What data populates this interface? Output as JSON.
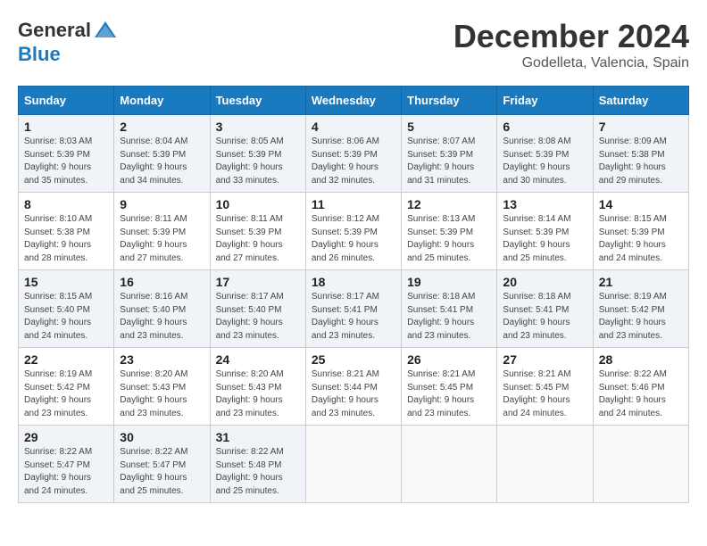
{
  "header": {
    "logo_general": "General",
    "logo_blue": "Blue",
    "month_title": "December 2024",
    "location": "Godelleta, Valencia, Spain"
  },
  "weekdays": [
    "Sunday",
    "Monday",
    "Tuesday",
    "Wednesday",
    "Thursday",
    "Friday",
    "Saturday"
  ],
  "weeks": [
    [
      {
        "day": "1",
        "sunrise": "8:03 AM",
        "sunset": "5:39 PM",
        "daylight": "9 hours and 35 minutes."
      },
      {
        "day": "2",
        "sunrise": "8:04 AM",
        "sunset": "5:39 PM",
        "daylight": "9 hours and 34 minutes."
      },
      {
        "day": "3",
        "sunrise": "8:05 AM",
        "sunset": "5:39 PM",
        "daylight": "9 hours and 33 minutes."
      },
      {
        "day": "4",
        "sunrise": "8:06 AM",
        "sunset": "5:39 PM",
        "daylight": "9 hours and 32 minutes."
      },
      {
        "day": "5",
        "sunrise": "8:07 AM",
        "sunset": "5:39 PM",
        "daylight": "9 hours and 31 minutes."
      },
      {
        "day": "6",
        "sunrise": "8:08 AM",
        "sunset": "5:39 PM",
        "daylight": "9 hours and 30 minutes."
      },
      {
        "day": "7",
        "sunrise": "8:09 AM",
        "sunset": "5:38 PM",
        "daylight": "9 hours and 29 minutes."
      }
    ],
    [
      {
        "day": "8",
        "sunrise": "8:10 AM",
        "sunset": "5:38 PM",
        "daylight": "9 hours and 28 minutes."
      },
      {
        "day": "9",
        "sunrise": "8:11 AM",
        "sunset": "5:39 PM",
        "daylight": "9 hours and 27 minutes."
      },
      {
        "day": "10",
        "sunrise": "8:11 AM",
        "sunset": "5:39 PM",
        "daylight": "9 hours and 27 minutes."
      },
      {
        "day": "11",
        "sunrise": "8:12 AM",
        "sunset": "5:39 PM",
        "daylight": "9 hours and 26 minutes."
      },
      {
        "day": "12",
        "sunrise": "8:13 AM",
        "sunset": "5:39 PM",
        "daylight": "9 hours and 25 minutes."
      },
      {
        "day": "13",
        "sunrise": "8:14 AM",
        "sunset": "5:39 PM",
        "daylight": "9 hours and 25 minutes."
      },
      {
        "day": "14",
        "sunrise": "8:15 AM",
        "sunset": "5:39 PM",
        "daylight": "9 hours and 24 minutes."
      }
    ],
    [
      {
        "day": "15",
        "sunrise": "8:15 AM",
        "sunset": "5:40 PM",
        "daylight": "9 hours and 24 minutes."
      },
      {
        "day": "16",
        "sunrise": "8:16 AM",
        "sunset": "5:40 PM",
        "daylight": "9 hours and 23 minutes."
      },
      {
        "day": "17",
        "sunrise": "8:17 AM",
        "sunset": "5:40 PM",
        "daylight": "9 hours and 23 minutes."
      },
      {
        "day": "18",
        "sunrise": "8:17 AM",
        "sunset": "5:41 PM",
        "daylight": "9 hours and 23 minutes."
      },
      {
        "day": "19",
        "sunrise": "8:18 AM",
        "sunset": "5:41 PM",
        "daylight": "9 hours and 23 minutes."
      },
      {
        "day": "20",
        "sunrise": "8:18 AM",
        "sunset": "5:41 PM",
        "daylight": "9 hours and 23 minutes."
      },
      {
        "day": "21",
        "sunrise": "8:19 AM",
        "sunset": "5:42 PM",
        "daylight": "9 hours and 23 minutes."
      }
    ],
    [
      {
        "day": "22",
        "sunrise": "8:19 AM",
        "sunset": "5:42 PM",
        "daylight": "9 hours and 23 minutes."
      },
      {
        "day": "23",
        "sunrise": "8:20 AM",
        "sunset": "5:43 PM",
        "daylight": "9 hours and 23 minutes."
      },
      {
        "day": "24",
        "sunrise": "8:20 AM",
        "sunset": "5:43 PM",
        "daylight": "9 hours and 23 minutes."
      },
      {
        "day": "25",
        "sunrise": "8:21 AM",
        "sunset": "5:44 PM",
        "daylight": "9 hours and 23 minutes."
      },
      {
        "day": "26",
        "sunrise": "8:21 AM",
        "sunset": "5:45 PM",
        "daylight": "9 hours and 23 minutes."
      },
      {
        "day": "27",
        "sunrise": "8:21 AM",
        "sunset": "5:45 PM",
        "daylight": "9 hours and 24 minutes."
      },
      {
        "day": "28",
        "sunrise": "8:22 AM",
        "sunset": "5:46 PM",
        "daylight": "9 hours and 24 minutes."
      }
    ],
    [
      {
        "day": "29",
        "sunrise": "8:22 AM",
        "sunset": "5:47 PM",
        "daylight": "9 hours and 24 minutes."
      },
      {
        "day": "30",
        "sunrise": "8:22 AM",
        "sunset": "5:47 PM",
        "daylight": "9 hours and 25 minutes."
      },
      {
        "day": "31",
        "sunrise": "8:22 AM",
        "sunset": "5:48 PM",
        "daylight": "9 hours and 25 minutes."
      },
      null,
      null,
      null,
      null
    ]
  ],
  "labels": {
    "sunrise": "Sunrise:",
    "sunset": "Sunset:",
    "daylight": "Daylight:"
  }
}
